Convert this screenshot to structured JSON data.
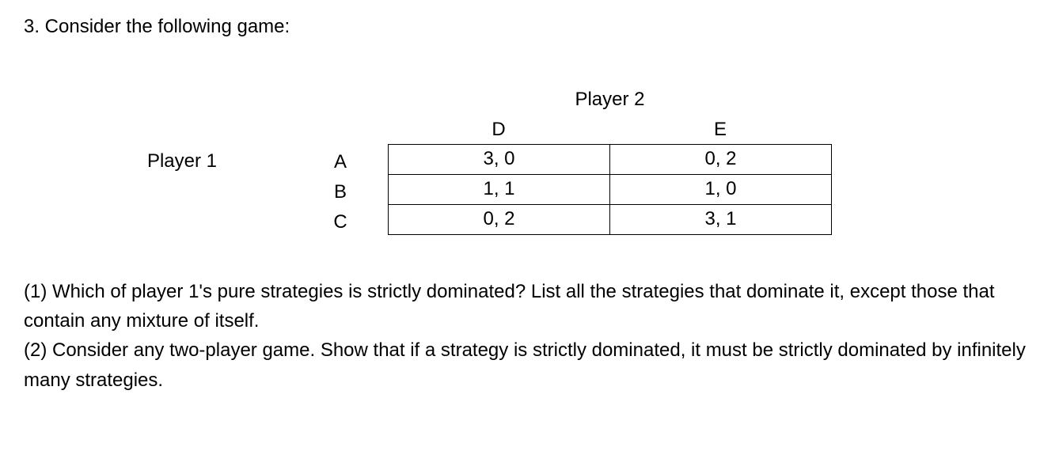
{
  "intro": "3.  Consider the following game:",
  "player2_label": "Player 2",
  "player1_label": "Player 1",
  "col_headers": {
    "d": "D",
    "e": "E"
  },
  "row_labels": {
    "a": "A",
    "b": "B",
    "c": "C"
  },
  "cells": {
    "ad": "3, 0",
    "ae": "0, 2",
    "bd": "1, 1",
    "be": "1, 0",
    "cd": "0, 2",
    "ce": "3, 1"
  },
  "q1": "(1)  Which of player 1's pure strategies is strictly dominated? List all the strategies that dominate it, except those that contain any mixture of itself.",
  "q2": "(2)  Consider any two-player game. Show that if a strategy is strictly dominated, it must be strictly dominated by infinitely many strategies."
}
